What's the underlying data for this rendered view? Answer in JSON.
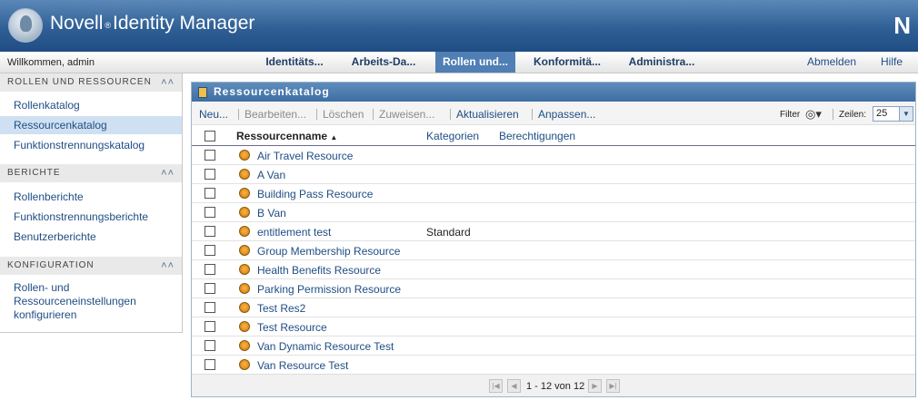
{
  "header": {
    "app_name_part1": "Novell",
    "reg_mark": "®",
    "app_name_part2": "Identity Manager",
    "corner_logo": "N"
  },
  "navbar": {
    "welcome": "Willkommen, admin",
    "tabs": [
      {
        "label": "Identitäts...",
        "active": false
      },
      {
        "label": "Arbeits-Da...",
        "active": false
      },
      {
        "label": "Rollen und...",
        "active": true
      },
      {
        "label": "Konformitä...",
        "active": false
      },
      {
        "label": "Administra...",
        "active": false
      }
    ],
    "logout": "Abmelden",
    "help": "Hilfe"
  },
  "sidebar": {
    "sections": [
      {
        "title": "ROLLEN UND RESSOURCEN",
        "items": [
          "Rollenkatalog",
          "Ressourcenkatalog",
          "Funktionstrennungskatalog"
        ],
        "selected_index": 1
      },
      {
        "title": "BERICHTE",
        "items": [
          "Rollenberichte",
          "Funktionstrennungsberichte",
          "Benutzerberichte"
        ]
      },
      {
        "title": "KONFIGURATION",
        "items": [
          "Rollen- und Ressourceneinstellungen konfigurieren"
        ]
      }
    ],
    "collapse_icon": "double-chevron-up-icon"
  },
  "panel": {
    "title": "Ressourcenkatalog",
    "toolbar": {
      "new": "Neu...",
      "edit": "Bearbeiten...",
      "delete": "Löschen",
      "assign": "Zuweisen...",
      "refresh": "Aktualisieren",
      "customize": "Anpassen...",
      "filter_label": "Filter",
      "rows_label": "Zeilen:",
      "rows_value": "25"
    },
    "columns": [
      "Ressourcenname",
      "Kategorien",
      "Berechtigungen"
    ],
    "sort_indicator": "▲",
    "rows": [
      {
        "name": "Air Travel Resource",
        "category": ""
      },
      {
        "name": "A Van",
        "category": ""
      },
      {
        "name": "Building Pass Resource",
        "category": ""
      },
      {
        "name": "B Van",
        "category": ""
      },
      {
        "name": "entitlement test",
        "category": "Standard"
      },
      {
        "name": "Group Membership Resource",
        "category": ""
      },
      {
        "name": "Health Benefits Resource",
        "category": ""
      },
      {
        "name": "Parking Permission Resource",
        "category": ""
      },
      {
        "name": "Test Res2",
        "category": ""
      },
      {
        "name": "Test Resource",
        "category": ""
      },
      {
        "name": "Van Dynamic Resource Test",
        "category": ""
      },
      {
        "name": "Van Resource Test",
        "category": ""
      }
    ],
    "pager": {
      "range": "1 - 12 von 12"
    }
  },
  "colors": {
    "header_blue": "#2f5f95",
    "active_tab": "#4f7fb4",
    "link_blue": "#1f4d84",
    "selected_item_bg": "#cfe0f2",
    "resource_icon": "#e59421"
  }
}
